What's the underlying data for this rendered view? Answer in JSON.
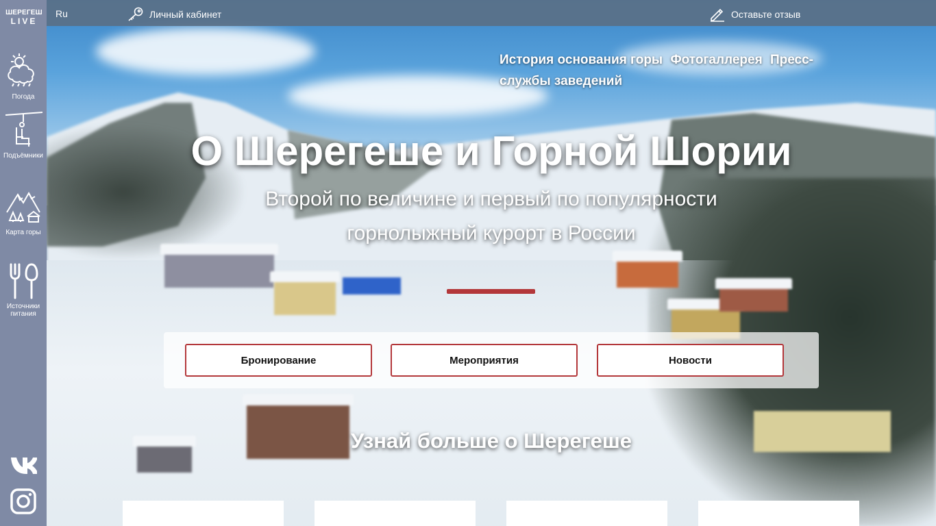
{
  "site": {
    "logo_line1": "ШЕРЕГЕШ",
    "logo_line2": "LIVE"
  },
  "topbar": {
    "language": "Ru",
    "cabinet_label": "Личный кабинет",
    "review_label": "Оставьте отзыв"
  },
  "sidebar": {
    "items": [
      {
        "label": "Погода",
        "icon": "weather-icon"
      },
      {
        "label": "Подъёмники",
        "icon": "ski-lift-icon"
      },
      {
        "label": "Карта горы",
        "icon": "mountain-map-icon"
      },
      {
        "label": "Источники питания",
        "icon": "fork-spoon-icon"
      }
    ],
    "social": [
      "vk-icon",
      "instagram-icon"
    ]
  },
  "top_menu": [
    "История основания горы",
    "Фотогаллерея",
    "Пресс-службы заведений"
  ],
  "hero": {
    "title": "О Шерегеше и Горной Шории",
    "subtitle": "Второй по величине и первый по популярности горнолыжный курорт в России"
  },
  "buttons": [
    "Бронирование",
    "Мероприятия",
    "Новости"
  ],
  "learn_more": "Узнай больше о Шерегеше",
  "colors": {
    "accent": "#b3373a",
    "sidebar": "#7f8aa5",
    "topbar": "#5a7087"
  }
}
